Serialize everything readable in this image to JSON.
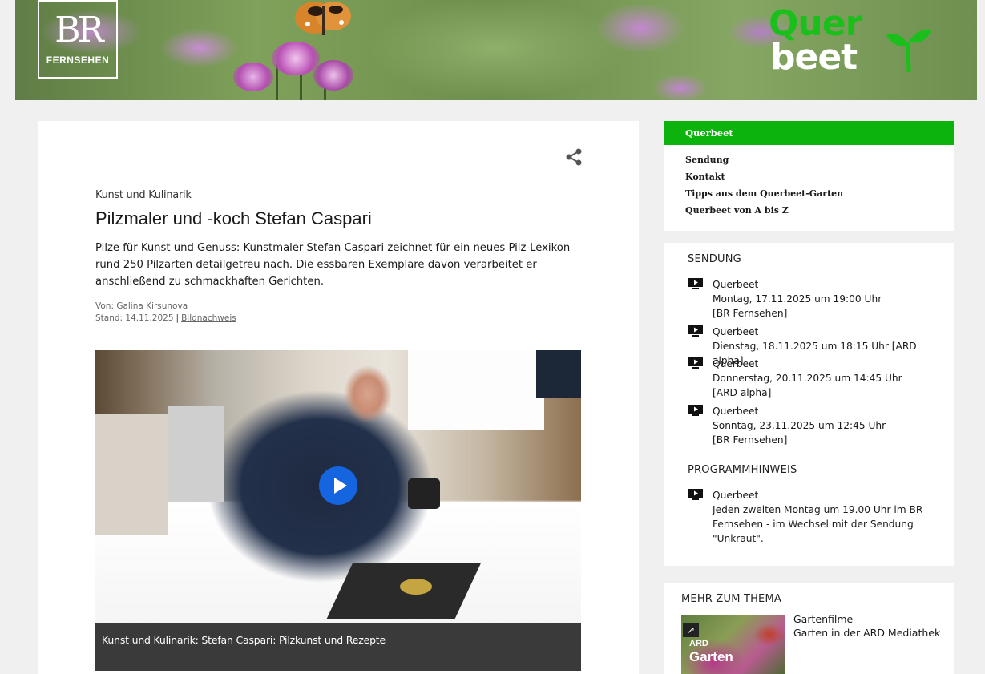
{
  "banner": {
    "br_logo_text": "BR",
    "br_logo_sub": "FERNSEHEN",
    "show_logo_line1": "Quer",
    "show_logo_line2": "beet"
  },
  "article": {
    "kicker": "Kunst und Kulinarik",
    "headline": "Pilzmaler und -koch Stefan Caspari",
    "teaser": "Pilze für Kunst und Genuss: Kunstmaler Stefan Caspari zeichnet für ein neues Pilz-Lexikon rund 250 Pilzarten detailgetreu nach. Die essbaren Exemplare davon verarbeitet er anschließend zu schmackhaften Gerichten.",
    "author": "Von: Galina Kirsunova",
    "stand": "Stand: 14.11.2025",
    "separator": "|",
    "credit_link": "Bildnachweis",
    "video_caption": "Kunst und Kulinarik: Stefan Caspari: Pilzkunst und Rezepte"
  },
  "nav": {
    "header": "Querbeet",
    "items": [
      {
        "label": "Sendung"
      },
      {
        "label": "Kontakt"
      },
      {
        "label": "Tipps aus dem Querbeet-Garten"
      },
      {
        "label": "Querbeet von A bis Z"
      }
    ]
  },
  "sendung": {
    "title": "SENDUNG",
    "entries": [
      {
        "name": "Querbeet",
        "line1": "Montag, 17.11.2025 um 19:00 Uhr",
        "line2": "[BR Fernsehen]"
      },
      {
        "name": "Querbeet",
        "line1": "Dienstag, 18.11.2025 um 18:15 Uhr [ARD alpha]",
        "line2": ""
      },
      {
        "name": "Querbeet",
        "line1": "Donnerstag, 20.11.2025 um 14:45 Uhr",
        "line2": "[ARD alpha]"
      },
      {
        "name": "Querbeet",
        "line1": "Sonntag, 23.11.2025 um 12:45 Uhr",
        "line2": "[BR Fernsehen]"
      }
    ]
  },
  "programmhinweis": {
    "title": "PROGRAMMHINWEIS",
    "name": "Querbeet",
    "line1": "Jeden zweiten Montag um 19.00 Uhr im BR",
    "line2": "Fernsehen - im Wechsel mit der Sendung",
    "line3": "\"Unkraut\"."
  },
  "mehr": {
    "title": "MEHR ZUM THEMA",
    "thumb_brand": "ARD",
    "thumb_title": "Garten",
    "link_title": "Gartenfilme",
    "link_sub": "Garten in der ARD Mediathek"
  },
  "icons": {
    "share": "share-icon",
    "play": "play-icon",
    "tv": "tv-play-icon",
    "external": "external-link-icon"
  },
  "colors": {
    "accent_green": "#0cb30c",
    "play_blue": "#1565e0",
    "caption_bg": "#3a3a3a",
    "page_bg": "#f0f0f0"
  }
}
